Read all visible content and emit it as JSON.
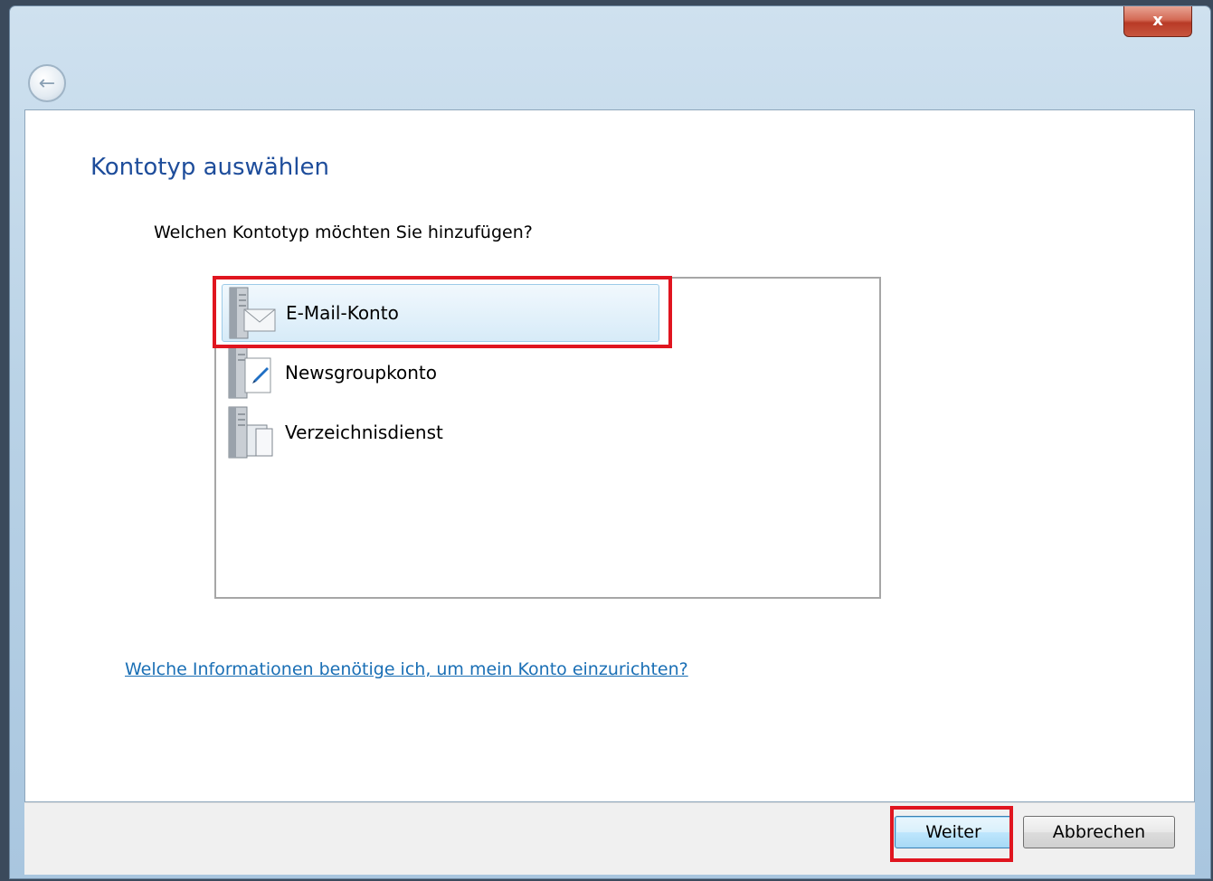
{
  "window": {
    "close_label": "x",
    "back_icon": "back-arrow-icon"
  },
  "page": {
    "title": "Kontotyp auswählen",
    "question": "Welchen Kontotyp möchten Sie hinzufügen?",
    "info_link": "Welche Informationen benötige ich, um mein Konto einzurichten?"
  },
  "account_types": {
    "selected_index": 0,
    "items": [
      {
        "label": "E-Mail-Konto",
        "icon": "email-server-icon"
      },
      {
        "label": "Newsgroupkonto",
        "icon": "newsgroup-server-icon"
      },
      {
        "label": "Verzeichnisdienst",
        "icon": "directory-server-icon"
      }
    ]
  },
  "footer": {
    "next_label": "Weiter",
    "cancel_label": "Abbrechen"
  },
  "colors": {
    "title": "#1e4d9b",
    "link": "#1a6fb5",
    "highlight": "#e0151f",
    "selection": "#d7ebf8"
  }
}
